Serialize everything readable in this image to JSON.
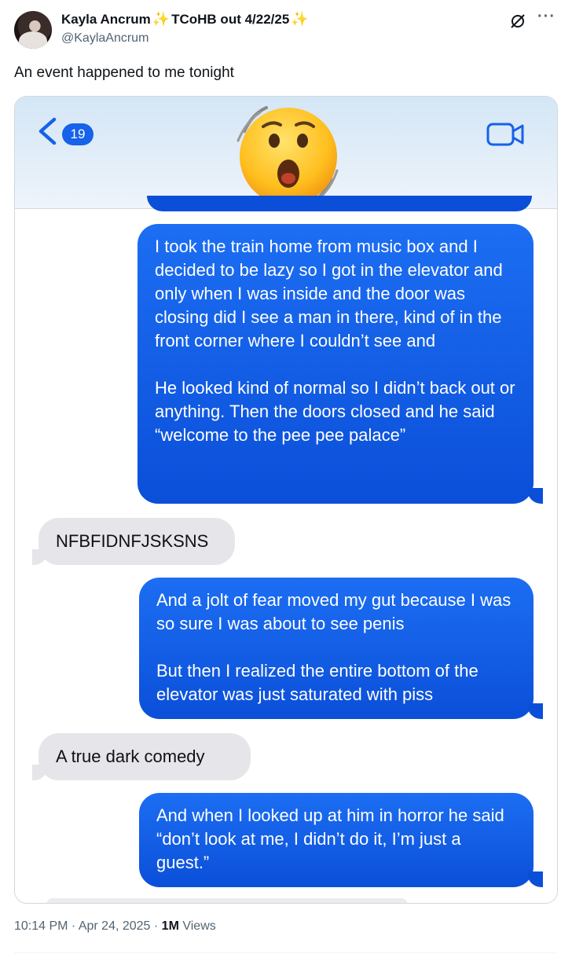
{
  "author": {
    "display_name": "Kayla Ancrum",
    "name_suffix": "TCoHB out 4/22/25",
    "sparkle": "✨",
    "handle": "@KaylaAncrum"
  },
  "tweet": {
    "text": "An event happened to me tonight"
  },
  "screenshot": {
    "unread_count": "19",
    "messages": [
      {
        "side": "sent",
        "paragraphs": [
          "I took the train home from music box and I decided to be lazy so I got in the elevator and only when I was inside and the door was closing did I see a man in there, kind of in the front corner where I couldn’t see and",
          "He looked kind of normal so I didn’t back out or anything. Then the doors closed and he said “welcome to the pee pee palace”"
        ]
      },
      {
        "side": "received",
        "paragraphs": [
          "NFBFIDNFJSKSNS"
        ]
      },
      {
        "side": "sent",
        "paragraphs": [
          "And a jolt of fear moved my gut because I was so sure I was about to see penis",
          "But then I realized the entire bottom of the elevator was just saturated with piss"
        ]
      },
      {
        "side": "received",
        "paragraphs": [
          "A true dark comedy"
        ]
      },
      {
        "side": "sent",
        "paragraphs": [
          "And when I looked up at him in horror he said “don’t look at me, I didn’t do it, I’m just a guest.”"
        ]
      }
    ]
  },
  "meta": {
    "time": "10:14 PM",
    "sep": " · ",
    "date": "Apr 24, 2025",
    "views_count": "1M",
    "views_label": " Views"
  },
  "colors": {
    "sent_bubble": "#1662e8",
    "received_bubble": "#e5e5ea",
    "secondary_text": "#536471"
  }
}
